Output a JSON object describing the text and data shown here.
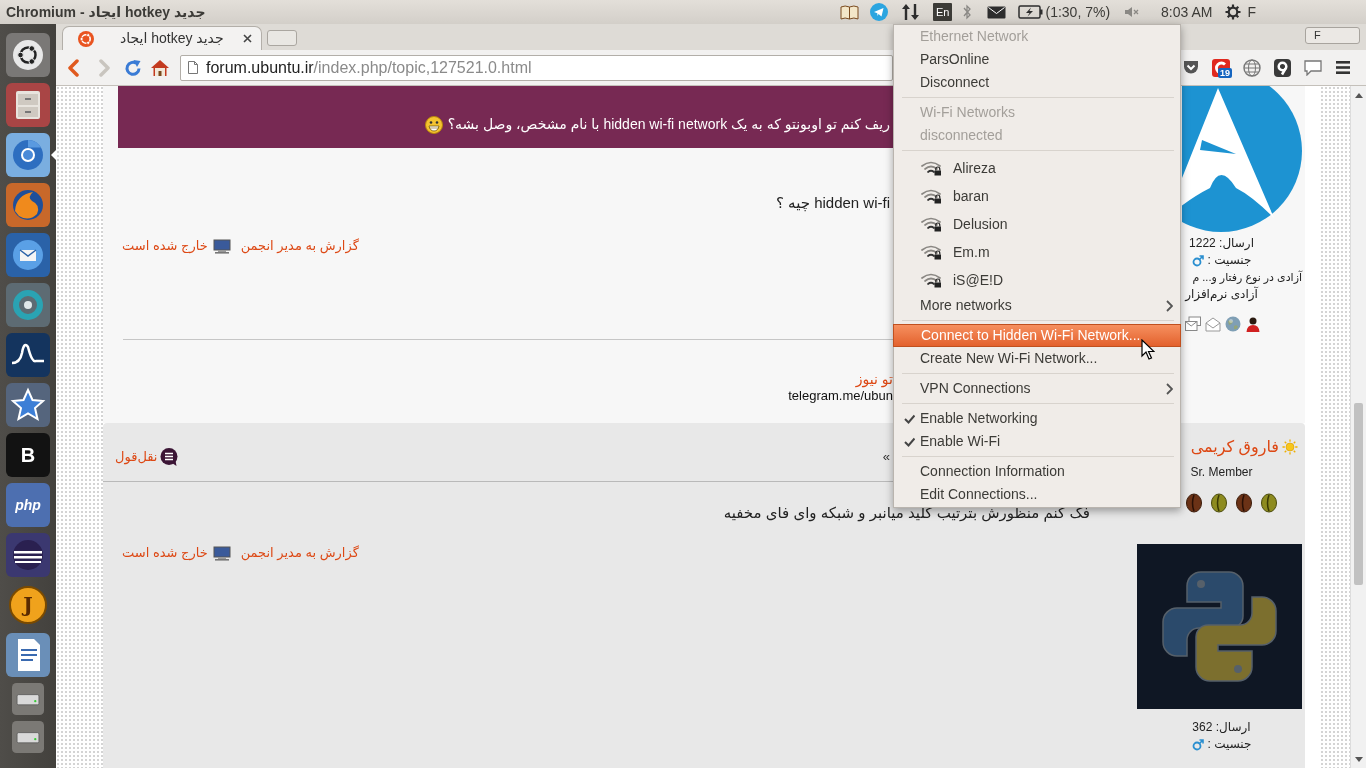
{
  "top_panel": {
    "window_title": "Chromium - ایجاد hotkey جدید",
    "keyboard_layout": "En",
    "battery": "(1:30, 7%)",
    "volume": {
      "muted": true
    },
    "clock": "8:03 AM",
    "user": "F"
  },
  "launcher": [
    {
      "kind": "dash",
      "focused": false
    },
    {
      "kind": "files",
      "focused": false
    },
    {
      "kind": "chromium",
      "focused": true
    },
    {
      "kind": "firefox",
      "focused": false
    },
    {
      "kind": "thunderbird",
      "focused": false
    },
    {
      "kind": "ring",
      "focused": false
    },
    {
      "kind": "wave",
      "focused": false
    },
    {
      "kind": "star",
      "focused": false
    },
    {
      "kind": "letter",
      "glyph": "B",
      "focused": false
    },
    {
      "kind": "php",
      "glyph": "php",
      "focused": false
    },
    {
      "kind": "eclipse",
      "focused": false
    },
    {
      "kind": "round_letter",
      "glyph": "J",
      "focused": false
    },
    {
      "kind": "writer",
      "focused": false
    },
    {
      "kind": "drive",
      "focused": false
    },
    {
      "kind": "drive",
      "focused": false
    }
  ],
  "browser": {
    "tabs": [
      {
        "title": "ایجاد hotkey جدید",
        "selected": true
      }
    ],
    "profile_button": "F",
    "nav_buttons": [
      {
        "kind": "back",
        "disabled": false
      },
      {
        "kind": "forward",
        "disabled": true
      },
      {
        "kind": "reload",
        "disabled": false
      },
      {
        "kind": "home",
        "disabled": false
      }
    ],
    "address": {
      "host": "forum.ubuntu.ir",
      "path": "/index.php/topic,127521.0.html"
    },
    "extensions": [
      {
        "kind": "pocket"
      },
      {
        "kind": "counter",
        "badge": "19"
      },
      {
        "kind": "globe"
      },
      {
        "kind": "pin"
      },
      {
        "kind": "comment"
      },
      {
        "kind": "menu"
      }
    ]
  },
  "posts": [
    {
      "quote": "ریف کنم تو اوبونتو که به یک hidden wi-fi network با نام مشخص، وصل بشه؟",
      "body": "hidden wi-fi چیه ؟",
      "report_link": "گزارش به مدیر انجمن",
      "status": "خارج شده است",
      "signature": [
        {
          "kind": "link",
          "text": "تو نیوز"
        },
        {
          "kind": "text",
          "text": "telegram.me/ubun"
        }
      ],
      "author": {
        "avatar": {
          "kind": "triangle"
        },
        "post_count": "ارسال: 1222",
        "gender_label": "جنسیت :",
        "personal_text": [
          "آزادی در نوع رفتار و... م",
          "آزادی نرم‌افزار"
        ],
        "profile_links": [
          {
            "kind": "messages"
          },
          {
            "kind": "email"
          },
          {
            "kind": "website"
          },
          {
            "kind": "profile"
          }
        ]
      }
    },
    {
      "quote_button": "نقل‌قول",
      "title": "»",
      "body": "فک کنم منظورش بترتیب کلید میانبر و شبکه وای فای مخفیه",
      "report_link": "گزارش به مدیر انجمن",
      "status": "خارج شده است",
      "author": {
        "name": "فاروق کریمی",
        "rank": "Sr. Member",
        "rank_icons": [
          {
            "kind": "dark"
          },
          {
            "kind": "light"
          },
          {
            "kind": "dark"
          },
          {
            "kind": "light"
          }
        ],
        "avatar": {
          "kind": "snakes"
        },
        "post_count": "ارسال: 362",
        "gender_label": "جنسیت :"
      }
    }
  ],
  "network_menu": {
    "sections": [
      {
        "items": [
          {
            "kind": "item",
            "label": "Ethernet Network",
            "disabled": true,
            "selected": false
          },
          {
            "kind": "item",
            "label": "ParsOnline",
            "disabled": false,
            "selected": false
          },
          {
            "kind": "item",
            "label": "Disconnect",
            "disabled": false,
            "selected": false
          }
        ]
      },
      {
        "items": [
          {
            "kind": "item",
            "label": "Wi-Fi Networks",
            "disabled": true,
            "selected": false
          },
          {
            "kind": "item",
            "label": "disconnected",
            "disabled": true,
            "selected": false
          }
        ]
      },
      {
        "items": [
          {
            "kind": "network",
            "label": "Alireza",
            "disabled": false,
            "selected": false
          },
          {
            "kind": "network",
            "label": "baran",
            "disabled": false,
            "selected": false
          },
          {
            "kind": "network",
            "label": "Delusion",
            "disabled": false,
            "selected": false
          },
          {
            "kind": "network",
            "label": "Em.m",
            "disabled": false,
            "selected": false
          },
          {
            "kind": "network",
            "label": "iS@E!D",
            "disabled": false,
            "selected": false
          },
          {
            "kind": "submenu",
            "label": "More networks",
            "disabled": false,
            "selected": false
          }
        ]
      },
      {
        "items": [
          {
            "kind": "item",
            "label": "Connect to Hidden Wi-Fi Network...",
            "disabled": false,
            "selected": true
          },
          {
            "kind": "item",
            "label": "Create New Wi-Fi Network...",
            "disabled": false,
            "selected": false
          }
        ]
      },
      {
        "items": [
          {
            "kind": "submenu",
            "label": "VPN Connections",
            "disabled": false,
            "selected": false
          }
        ]
      },
      {
        "items": [
          {
            "kind": "check",
            "label": "Enable Networking",
            "checked": true,
            "disabled": false,
            "selected": false
          },
          {
            "kind": "check",
            "label": "Enable Wi-Fi",
            "checked": true,
            "disabled": false,
            "selected": false
          }
        ]
      },
      {
        "items": [
          {
            "kind": "item",
            "label": "Connection Information",
            "disabled": false,
            "selected": false
          },
          {
            "kind": "item",
            "label": "Edit Connections...",
            "disabled": false,
            "selected": false
          }
        ]
      }
    ]
  }
}
